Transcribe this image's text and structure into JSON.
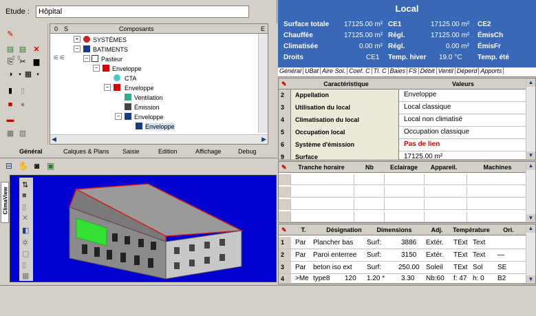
{
  "etude": {
    "label": "Etude :",
    "value": "Hôpital"
  },
  "tree": {
    "headers": [
      "0",
      "S",
      "Composants",
      "E"
    ],
    "items": [
      {
        "label": "SYSTÈMES",
        "icon": "systems-icon"
      },
      {
        "label": "BATIMENTS",
        "icon": "building-icon"
      },
      {
        "label": "Pasteur",
        "icon": "building-small-icon"
      },
      {
        "label": "Enveloppe",
        "icon": "envelope-icon"
      },
      {
        "label": "CTA",
        "icon": "cta-icon"
      },
      {
        "label": "Enveloppe",
        "icon": "envelope-icon"
      },
      {
        "label": "Ventilation",
        "icon": "ventilation-icon"
      },
      {
        "label": "Émission",
        "icon": "emission-icon"
      },
      {
        "label": "Enveloppe",
        "icon": "envelope-icon"
      },
      {
        "label": "Enveloppe",
        "icon": "envelope-icon"
      }
    ]
  },
  "view_tabs": [
    "Général",
    "Calques & Plans",
    "Saisie",
    "Edition",
    "Affichage",
    "Debug"
  ],
  "side_tab": "ClimaView",
  "local": {
    "title": "Local",
    "rows": [
      {
        "label": "Surface totale",
        "v1": "17125.00 m²",
        "code": "CE1",
        "v2": "17125.00 m²",
        "right": "CE2"
      },
      {
        "label": "Chauffée",
        "v1": "17125.00 m²",
        "code": "Régl.",
        "v2": "17125.00 m²",
        "right": "ÉmisCh"
      },
      {
        "label": "Climatisée",
        "v1": "0.00 m²",
        "code": "Régl.",
        "v2": "0.00 m²",
        "right": "ÉmisFr"
      },
      {
        "label": "Droits",
        "v1": "CE1",
        "code": "Temp. hiver",
        "v2": "19.0 °C",
        "right": "Temp. été"
      }
    ],
    "subtabs": [
      "Général",
      "UBat",
      "Aire Sol.",
      "Coef. C",
      "Tl. C",
      "Baies",
      "FS",
      "Débit",
      "Ventil",
      "Déperd",
      "Apports"
    ]
  },
  "characteristics": {
    "headers": [
      "Caractéristique",
      "Valeurs"
    ],
    "rows": [
      {
        "n": "2",
        "key": "Appellation",
        "value": "Enveloppe",
        "color": "#000000"
      },
      {
        "n": "3",
        "key": "Utilisation du local",
        "value": "Local classique",
        "color": "#000000"
      },
      {
        "n": "4",
        "key": "Climatisation du local",
        "value": "Local non climatisé",
        "color": "#000000"
      },
      {
        "n": "5",
        "key": "Occupation local",
        "value": "Occupation classique",
        "color": "#000000"
      },
      {
        "n": "6",
        "key": "Système d'émission",
        "value": "Pas de lien",
        "color": "#e00000"
      },
      {
        "n": "9",
        "key": "Surface",
        "value": "17125.00 m²",
        "color": "#000000"
      }
    ]
  },
  "machines": {
    "headers": [
      "Tranche horaire",
      "Nb",
      "Eclairage",
      "Appareil.",
      "Machines"
    ]
  },
  "walls": {
    "headers": [
      "T.",
      "Désignation",
      "Dimensions",
      "Adj.",
      "Température",
      "Ori."
    ],
    "rows": [
      [
        "1",
        "Par",
        "Plancher bas",
        "",
        "Surf:",
        "3886",
        "Extér.",
        "TExt",
        "Text",
        ""
      ],
      [
        "2",
        "Par",
        "Paroi enterree",
        "",
        "Surf:",
        "3150",
        "Extér.",
        "TExt",
        "Text",
        "—"
      ],
      [
        "3",
        "Par",
        "beton iso ext",
        "",
        "Surf:",
        "250.00",
        "Soleil",
        "TExt",
        "Sol",
        "SE"
      ],
      [
        "4",
        ">Me",
        "type8",
        "120",
        "1.20 *",
        "3.30",
        "Nb:60",
        "f: 47",
        "h: 0",
        "B2"
      ]
    ]
  }
}
